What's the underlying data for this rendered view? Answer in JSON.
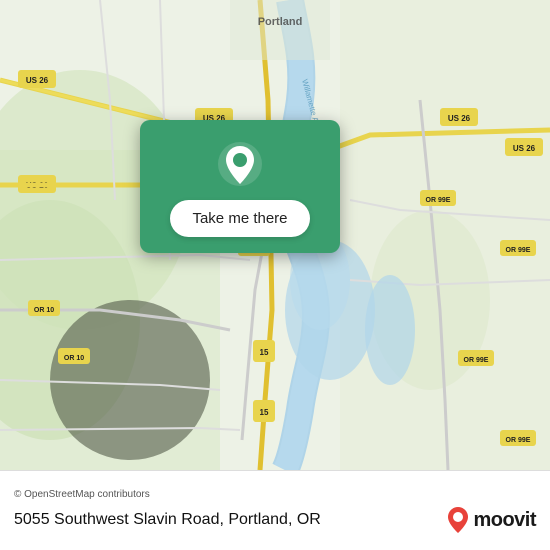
{
  "map": {
    "alt": "Portland Oregon map"
  },
  "card": {
    "button_label": "Take me there",
    "pin_icon": "location-pin"
  },
  "bottom_bar": {
    "copyright": "© OpenStreetMap contributors",
    "address": "5055 Southwest Slavin Road, Portland, OR",
    "moovit_label": "moovit"
  }
}
